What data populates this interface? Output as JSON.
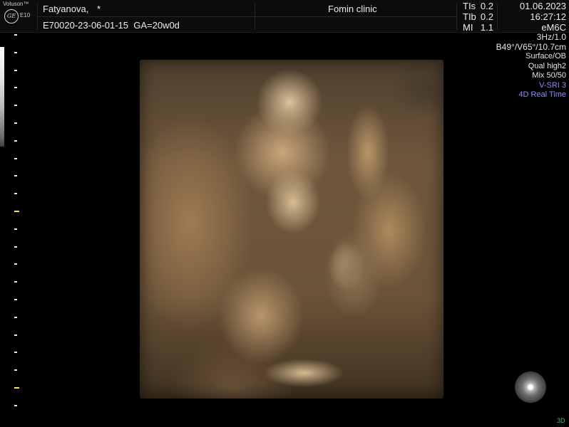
{
  "header": {
    "logo": {
      "brand": "Voluson™",
      "emblem": "GE",
      "model": "E10"
    },
    "patient_name": "Fatyanova,",
    "patient_flag": "*",
    "exam_id": "E70020-23-06-01-15",
    "gestational_age": "GA=20w0d",
    "clinic": "Fomin clinic",
    "indices": [
      {
        "label": "TIs",
        "value": "0.2"
      },
      {
        "label": "TIb",
        "value": "0.2"
      },
      {
        "label": "MI",
        "value": "1.1"
      }
    ],
    "date": "01.06.2023",
    "time": "16:27:12",
    "probe": "eM6C"
  },
  "params": {
    "frequency": "3Hz/1.0",
    "angles_depth": "B49°/V65°/10.7cm",
    "render_mode": "Surface/OB",
    "quality": "Qual high2",
    "mix": "Mix 50/50",
    "vsri": "V-SRI 3",
    "live_mode": "4D Real Time"
  },
  "icons": {
    "logo": "ge-logo-icon",
    "orientation": "orientation-ball-icon",
    "depth_scale": "depth-scale-icon",
    "grey_bar": "grey-map-icon"
  },
  "colors": {
    "accent_blue": "#8a8cff",
    "marker_yellow": "#ffe066",
    "mode_green": "#3fbf5f"
  },
  "view_mode": "3D"
}
